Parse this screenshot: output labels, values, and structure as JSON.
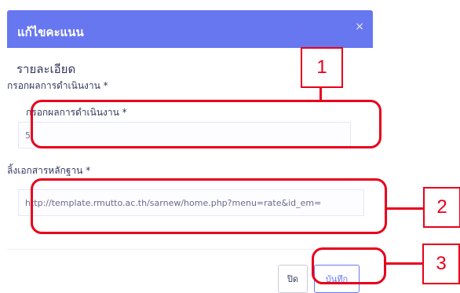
{
  "modal": {
    "title": "แก้ไขคะแนน",
    "close_glyph": "×",
    "section_title": "รายละเอียด",
    "group_label": "กรอกผลการดำเนินงาน *",
    "result_field": {
      "label": "กรอกผลการดำเนินงาน *",
      "value": "5"
    },
    "link_field": {
      "label": "ลิ้งเอกสารหลักฐาน *",
      "value": "http://template.rmutto.ac.th/sarnew/home.php?menu=rate&id_em="
    },
    "buttons": {
      "close_label": "ปิด",
      "save_label": "บันทึก"
    }
  },
  "annotations": {
    "color": "#e8001c",
    "callouts": [
      "1",
      "2",
      "3"
    ]
  },
  "colors": {
    "header": "#6777ef"
  }
}
